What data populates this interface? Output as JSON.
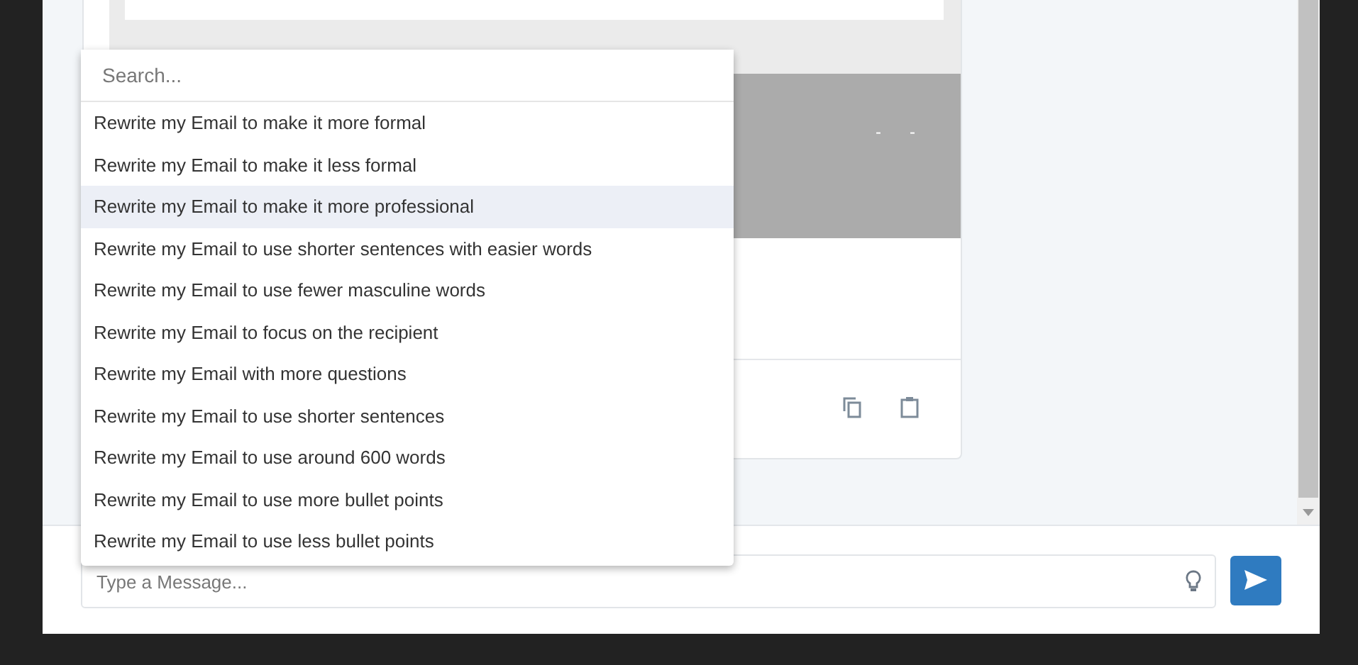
{
  "message_card": {
    "media_marks": [
      "-",
      "-"
    ],
    "actions": [
      {
        "kind": "copy"
      },
      {
        "kind": "paste"
      }
    ]
  },
  "prompt_menu": {
    "search": {
      "placeholder": "Search..."
    },
    "items": [
      {
        "label": "Rewrite my Email to make it more formal",
        "selected": false
      },
      {
        "label": "Rewrite my Email to make it less formal",
        "selected": false
      },
      {
        "label": "Rewrite my Email to make it more professional",
        "selected": true
      },
      {
        "label": "Rewrite my Email to use shorter sentences with easier words",
        "selected": false
      },
      {
        "label": "Rewrite my Email to use fewer masculine words",
        "selected": false
      },
      {
        "label": "Rewrite my Email to focus on the recipient",
        "selected": false
      },
      {
        "label": "Rewrite my Email with more questions",
        "selected": false
      },
      {
        "label": "Rewrite my Email to use shorter sentences",
        "selected": false
      },
      {
        "label": "Rewrite my Email to use around 600 words",
        "selected": false
      },
      {
        "label": "Rewrite my Email to use more bullet points",
        "selected": false
      },
      {
        "label": "Rewrite my Email to use less bullet points",
        "selected": false
      }
    ]
  },
  "composer": {
    "placeholder": "Type a Message..."
  }
}
